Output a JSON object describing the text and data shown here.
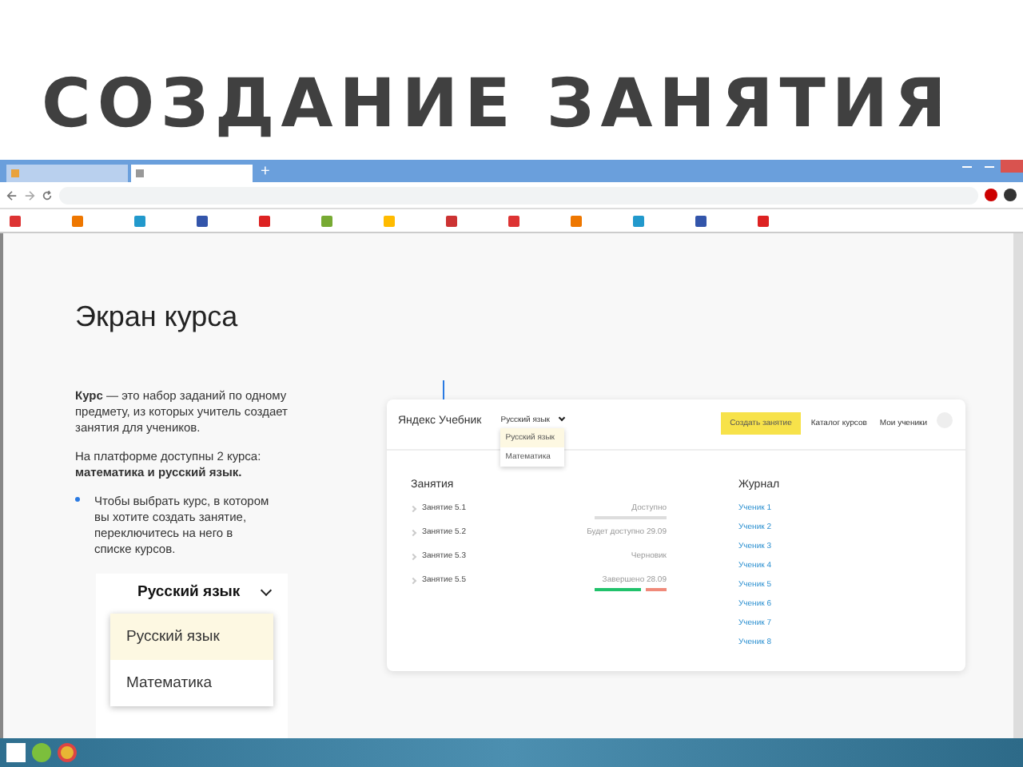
{
  "slide_title": "СОЗДАНИЕ ЗАНЯТИЯ",
  "browser": {
    "tabs": [
      {
        "selected": false
      },
      {
        "selected": true
      }
    ],
    "new_tab": "+",
    "bookmarks": [
      {
        "color": "#dd3333"
      },
      {
        "color": "#ee7700"
      },
      {
        "color": "#2299cc"
      },
      {
        "color": "#3355aa"
      },
      {
        "color": "#dd2222"
      },
      {
        "color": "#77aa33"
      },
      {
        "color": "#ffbb00"
      },
      {
        "color": "#cc3333"
      },
      {
        "color": "#dd3333"
      },
      {
        "color": "#ee7700"
      },
      {
        "color": "#2299cc"
      },
      {
        "color": "#3355aa"
      },
      {
        "color": "#dd2222"
      }
    ]
  },
  "page": {
    "heading": "Экран курса",
    "paragraphs": [
      "**Курс** — это набор заданий по одному предмету, из которых учитель создает занятия для учеников.",
      "На платформе доступны 2 курса: **математика и русский язык.**"
    ],
    "hint": "Чтобы выбрать курс, в котором вы хотите создать занятие, переключитесь на него в списке курсов.",
    "course_select": {
      "value": "Русский язык",
      "options": [
        {
          "label": "Русский язык",
          "selected": true
        },
        {
          "label": "Математика",
          "selected": false
        }
      ]
    },
    "app": {
      "logo": "Яндекс Учебник",
      "course": "Русский язык",
      "menu": [
        {
          "label": "Русский язык",
          "selected": true
        },
        {
          "label": "Математика",
          "selected": false
        }
      ],
      "create_button": "Создать занятие",
      "nav": [
        "Каталог курсов",
        "Мои ученики"
      ],
      "lessons_title": "Занятия",
      "lessons": [
        {
          "title": "Занятие 5.1",
          "status": "Доступно",
          "kind": "open",
          "level": 0
        },
        {
          "title": "Занятие 5.2",
          "status": "Будет доступно 29.09",
          "kind": "scheduled"
        },
        {
          "title": "Занятие 5.3",
          "status": "Черновик",
          "kind": "draft"
        },
        {
          "title": "Занятие 5.5",
          "status": "Завершено 28.09",
          "kind": "finished",
          "level": 0.65
        }
      ],
      "journal_title": "Журнал",
      "students": [
        "Ученик 1",
        "Ученик 2",
        "Ученик 3",
        "Ученик 4",
        "Ученик 5",
        "Ученик 6",
        "Ученик 7",
        "Ученик 8"
      ]
    }
  }
}
